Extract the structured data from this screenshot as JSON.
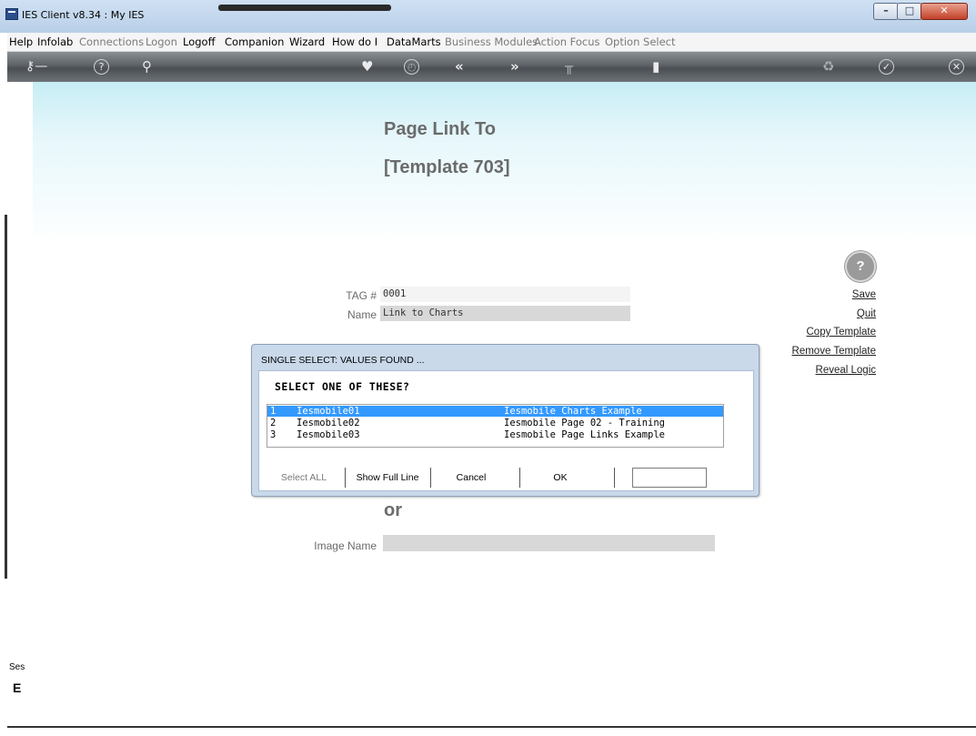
{
  "window": {
    "title": "IES Client v8.34 : My IES"
  },
  "menu": {
    "items": [
      {
        "label": "Help",
        "enabled": true
      },
      {
        "label": "Infolab",
        "enabled": true
      },
      {
        "label": "Connections",
        "enabled": false
      },
      {
        "label": "Logon",
        "enabled": false
      },
      {
        "label": "Logoff",
        "enabled": true
      },
      {
        "label": "Companion",
        "enabled": true
      },
      {
        "label": "Wizard",
        "enabled": true
      },
      {
        "label": "How do I",
        "enabled": true
      },
      {
        "label": "DataMarts",
        "enabled": true
      },
      {
        "label": "Business Modules",
        "enabled": false
      },
      {
        "label": "Action Focus",
        "enabled": false
      },
      {
        "label": "Option Select",
        "enabled": false
      }
    ]
  },
  "toolbar": {
    "icons": [
      "key-icon",
      "help-icon",
      "search-icon",
      "heart-icon",
      "clock-icon",
      "back-icon",
      "forward-icon",
      "bar-icon",
      "tablet-icon",
      "recycle-icon",
      "check-icon",
      "close-icon"
    ]
  },
  "page": {
    "title": "Page Link To",
    "subtitle": "[Template 703]",
    "tag_label": "TAG #",
    "tag_value": "0001",
    "name_label": "Name",
    "name_value": "Link to Charts",
    "or_text": "or",
    "image_label": "Image Name",
    "image_value": ""
  },
  "right_links": {
    "help": "?",
    "save": "Save",
    "quit": "Quit",
    "copy": "Copy Template",
    "remove": "Remove Template",
    "reveal": "Reveal Logic"
  },
  "sidebar": {
    "ses": "Ses",
    "glyph": "E"
  },
  "dialog": {
    "title": "SINGLE SELECT: VALUES FOUND ...",
    "question": "SELECT ONE OF THESE?",
    "rows": [
      {
        "num": "1",
        "code": "Iesmobile01",
        "desc": "Iesmobile Charts Example",
        "selected": true
      },
      {
        "num": "2",
        "code": "Iesmobile02",
        "desc": "Iesmobile Page 02 - Training",
        "selected": false
      },
      {
        "num": "3",
        "code": "Iesmobile03",
        "desc": "Iesmobile Page Links Example",
        "selected": false
      }
    ],
    "buttons": {
      "select_all": "Select ALL",
      "show_full": "Show Full Line",
      "cancel": "Cancel",
      "ok": "OK"
    },
    "input_value": ""
  }
}
